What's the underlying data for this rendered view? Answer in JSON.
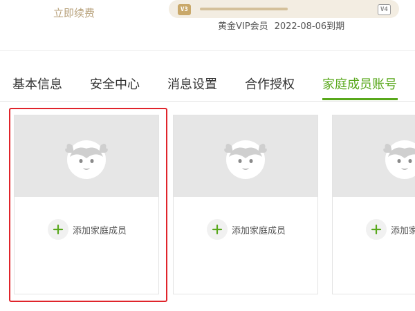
{
  "membership": {
    "renew_link": "立即续费",
    "current_level": "V3",
    "next_level": "V4",
    "vip_name": "黄金VIP会员",
    "expiry": "2022-08-06到期",
    "level_progress": 0.55
  },
  "tabs": [
    {
      "label": "基本信息",
      "active": false
    },
    {
      "label": "安全中心",
      "active": false
    },
    {
      "label": "消息设置",
      "active": false
    },
    {
      "label": "合作授权",
      "active": false
    },
    {
      "label": "家庭成员账号",
      "active": true
    }
  ],
  "family_cards": [
    {
      "add_label": "添加家庭成员",
      "selected": true
    },
    {
      "add_label": "添加家庭成员",
      "selected": false
    },
    {
      "add_label": "添加家庭成员",
      "selected": false
    }
  ],
  "colors": {
    "accent_green": "#58a81b",
    "gold": "#c9a86a",
    "highlight_red": "#e0242b"
  }
}
